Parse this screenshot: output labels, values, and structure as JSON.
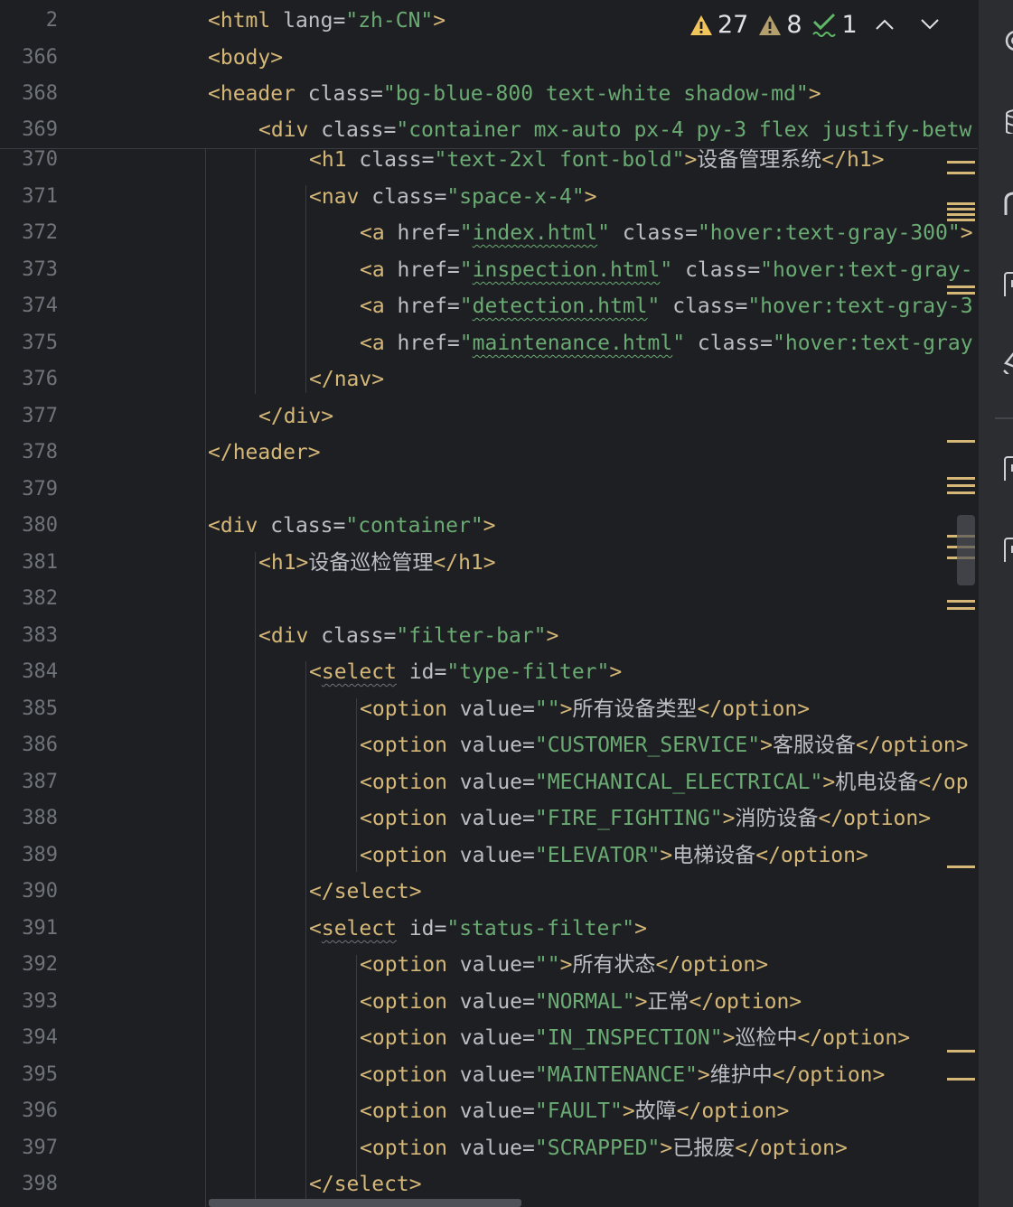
{
  "inspections": {
    "errors": "27",
    "warnings": "8",
    "typos": "1",
    "colors": {
      "warning": "#f2c55c",
      "ok": "#5fb865"
    }
  },
  "right_toolbar": {
    "icons": [
      "ai-assistant-icon",
      "database-icon",
      "remote-icon",
      "notifications-icon",
      "plugin-icon",
      "structure-icon",
      "bookmarks-icon"
    ]
  },
  "sticky_lines": [
    {
      "num": "2",
      "code": "<html lang=\"zh-CN\">"
    },
    {
      "num": "366",
      "code": "<body>"
    },
    {
      "num": "368",
      "code": "<header class=\"bg-blue-800 text-white shadow-md\">"
    },
    {
      "num": "369",
      "code": "<div class=\"container mx-auto px-4 py-3 flex justify-betw"
    }
  ],
  "lines": [
    {
      "num": "370",
      "code": "<h1 class=\"text-2xl font-bold\">设备管理系统</h1>"
    },
    {
      "num": "371",
      "code": "<nav class=\"space-x-4\">"
    },
    {
      "num": "372",
      "code": "<a href=\"index.html\" class=\"hover:text-gray-300\">"
    },
    {
      "num": "373",
      "code": "<a href=\"inspection.html\" class=\"hover:text-gray-"
    },
    {
      "num": "374",
      "code": "<a href=\"detection.html\" class=\"hover:text-gray-3"
    },
    {
      "num": "375",
      "code": "<a href=\"maintenance.html\" class=\"hover:text-gray"
    },
    {
      "num": "376",
      "code": "</nav>"
    },
    {
      "num": "377",
      "code": "</div>"
    },
    {
      "num": "378",
      "code": "</header>"
    },
    {
      "num": "379",
      "code": ""
    },
    {
      "num": "380",
      "code": "<div class=\"container\">"
    },
    {
      "num": "381",
      "code": "<h1>设备巡检管理</h1>"
    },
    {
      "num": "382",
      "code": ""
    },
    {
      "num": "383",
      "code": "<div class=\"filter-bar\">"
    },
    {
      "num": "384",
      "code": "<select id=\"type-filter\">"
    },
    {
      "num": "385",
      "code": "<option value=\"\">所有设备类型</option>"
    },
    {
      "num": "386",
      "code": "<option value=\"CUSTOMER_SERVICE\">客服设备</option>"
    },
    {
      "num": "387",
      "code": "<option value=\"MECHANICAL_ELECTRICAL\">机电设备</op"
    },
    {
      "num": "388",
      "code": "<option value=\"FIRE_FIGHTING\">消防设备</option>"
    },
    {
      "num": "389",
      "code": "<option value=\"ELEVATOR\">电梯设备</option>"
    },
    {
      "num": "390",
      "code": "</select>"
    },
    {
      "num": "391",
      "code": "<select id=\"status-filter\">"
    },
    {
      "num": "392",
      "code": "<option value=\"\">所有状态</option>"
    },
    {
      "num": "393",
      "code": "<option value=\"NORMAL\">正常</option>"
    },
    {
      "num": "394",
      "code": "<option value=\"IN_INSPECTION\">巡检中</option>"
    },
    {
      "num": "395",
      "code": "<option value=\"MAINTENANCE\">维护中</option>"
    },
    {
      "num": "396",
      "code": "<option value=\"FAULT\">故障</option>"
    },
    {
      "num": "397",
      "code": "<option value=\"SCRAPPED\">已报废</option>"
    },
    {
      "num": "398",
      "code": "</select>"
    }
  ]
}
